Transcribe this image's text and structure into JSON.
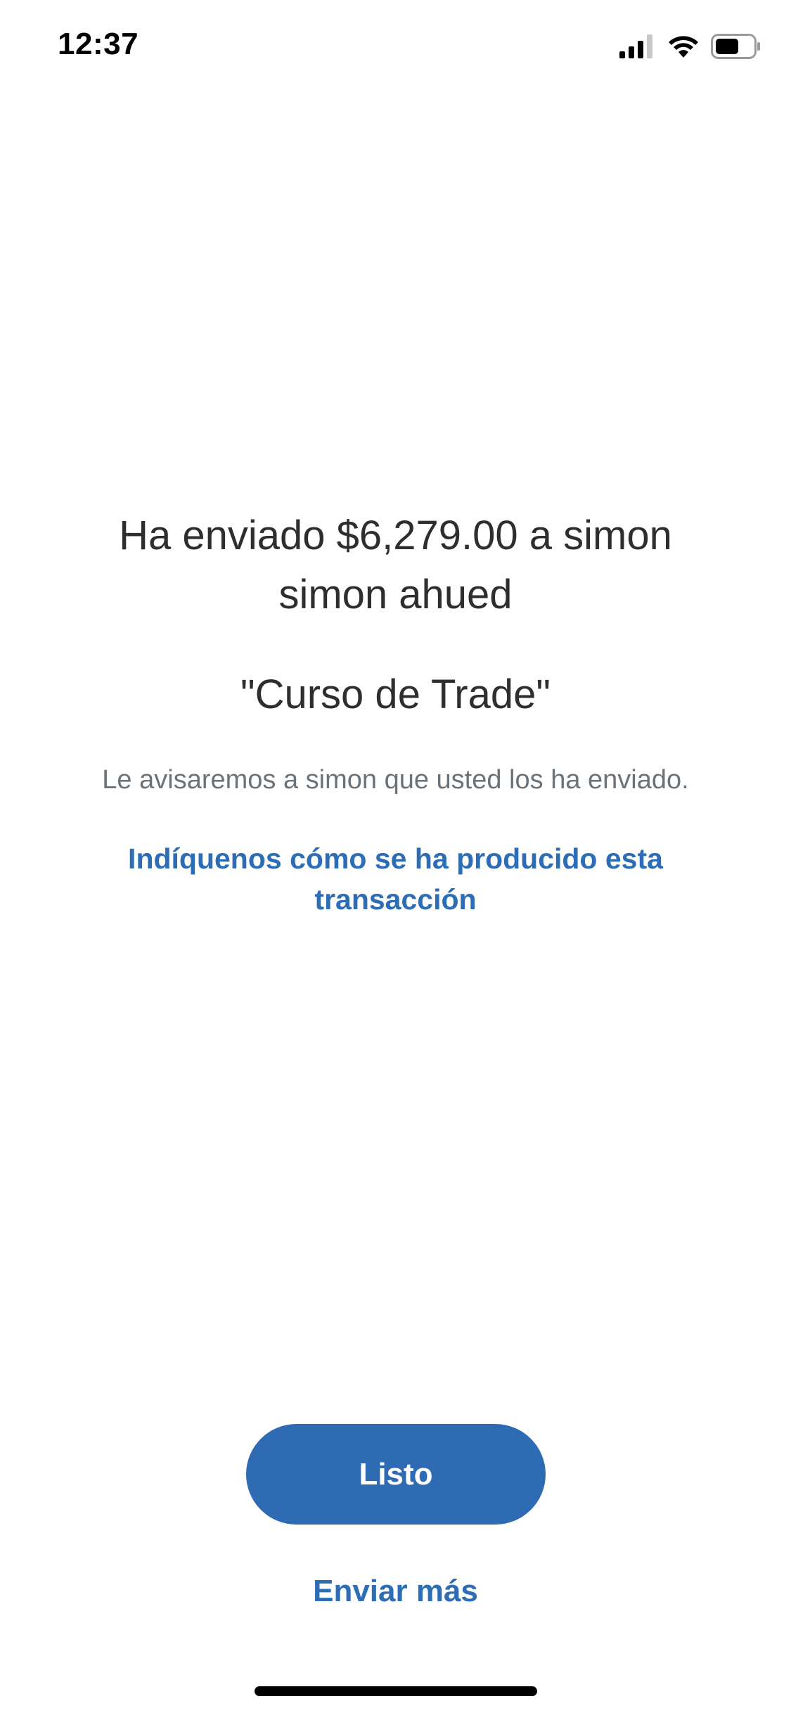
{
  "status_bar": {
    "time": "12:37",
    "icons": [
      "cellular-signal-icon",
      "wifi-icon",
      "battery-icon"
    ]
  },
  "confirmation": {
    "headline": "Ha enviado $6,279.00 a simon simon ahued",
    "note": "\"Curso de Trade\"",
    "info": "Le avisaremos a simon que usted los ha enviado.",
    "feedback_link": "Indíquenos cómo se ha producido esta transacción"
  },
  "actions": {
    "done_label": "Listo",
    "send_more_label": "Enviar más"
  },
  "colors": {
    "accent": "#2f6bb3",
    "link": "#2c6db5",
    "text_primary": "#2c2e2f",
    "text_secondary": "#6c7378"
  }
}
